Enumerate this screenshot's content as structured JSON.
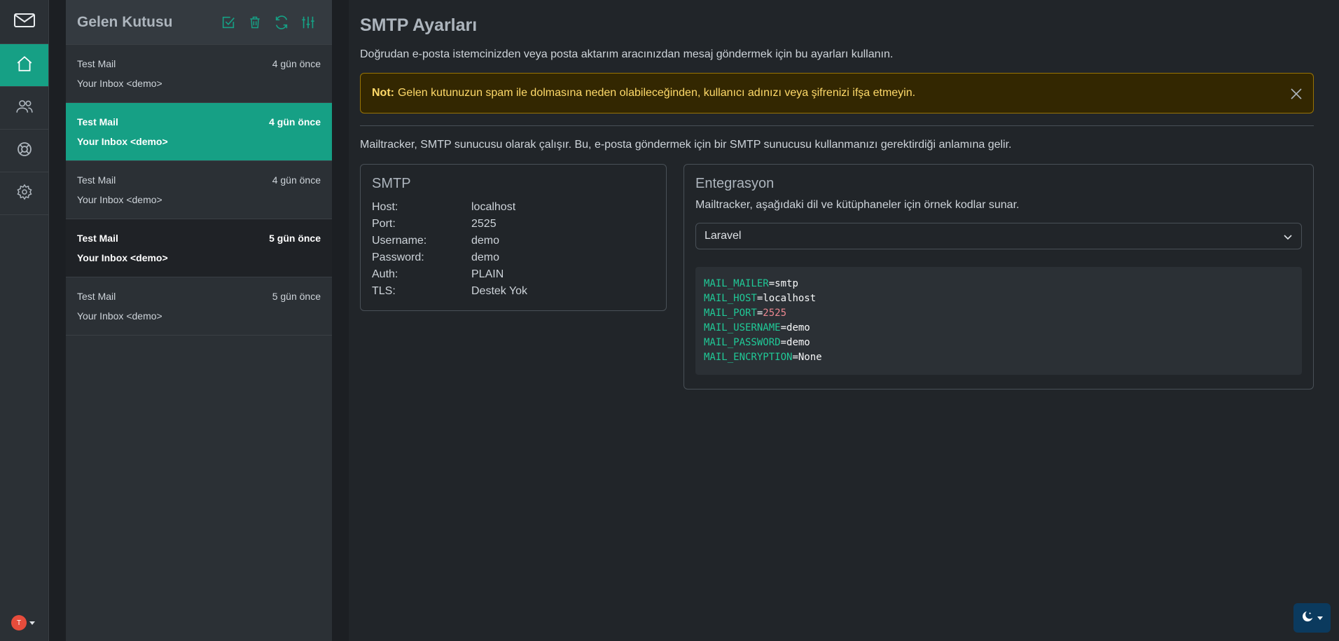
{
  "sidebar": {
    "logo": "mail-icon",
    "items": [
      {
        "icon": "home-icon",
        "active": true
      },
      {
        "icon": "users-icon",
        "active": false
      },
      {
        "icon": "help-icon",
        "active": false
      },
      {
        "icon": "gear-icon",
        "active": false
      }
    ],
    "avatar_initial": "T"
  },
  "inbox": {
    "title": "Gelen Kutusu",
    "mails": [
      {
        "subject": "Test Mail",
        "time": "4 gün önce",
        "from": "Your Inbox <demo>",
        "state": "read"
      },
      {
        "subject": "Test Mail",
        "time": "4 gün önce",
        "from": "Your Inbox <demo>",
        "state": "selected"
      },
      {
        "subject": "Test Mail",
        "time": "4 gün önce",
        "from": "Your Inbox <demo>",
        "state": "read"
      },
      {
        "subject": "Test Mail",
        "time": "5 gün önce",
        "from": "Your Inbox <demo>",
        "state": "unread"
      },
      {
        "subject": "Test Mail",
        "time": "5 gün önce",
        "from": "Your Inbox <demo>",
        "state": "read"
      }
    ]
  },
  "main": {
    "title": "SMTP Ayarları",
    "description": "Doğrudan e-posta istemcinizden veya posta aktarım aracınızdan mesaj göndermek için bu ayarları kullanın.",
    "alert": {
      "label": "Not:",
      "text": "Gelen kutunuzun spam ile dolmasına neden olabileceğinden, kullanıcı adınızı veya şifrenizi ifşa etmeyin."
    },
    "info": "Mailtracker, SMTP sunucusu olarak çalışır. Bu, e-posta göndermek için bir SMTP sunucusu kullanmanızı gerektirdiği anlamına gelir.",
    "smtp": {
      "title": "SMTP",
      "rows": [
        {
          "key": "Host:",
          "value": "localhost"
        },
        {
          "key": "Port:",
          "value": "2525"
        },
        {
          "key": "Username:",
          "value": "demo"
        },
        {
          "key": "Password:",
          "value": "demo"
        },
        {
          "key": "Auth:",
          "value": "PLAIN"
        },
        {
          "key": "TLS:",
          "value": "Destek Yok"
        }
      ]
    },
    "integration": {
      "title": "Entegrasyon",
      "description": "Mailtracker, aşağıdaki dil ve kütüphaneler için örnek kodlar sunar.",
      "selected": "Laravel",
      "code": [
        {
          "key": "MAIL_MAILER",
          "value": "smtp",
          "numeric": false
        },
        {
          "key": "MAIL_HOST",
          "value": "localhost",
          "numeric": false
        },
        {
          "key": "MAIL_PORT",
          "value": "2525",
          "numeric": true
        },
        {
          "key": "MAIL_USERNAME",
          "value": "demo",
          "numeric": false
        },
        {
          "key": "MAIL_PASSWORD",
          "value": "demo",
          "numeric": false
        },
        {
          "key": "MAIL_ENCRYPTION",
          "value": "None",
          "numeric": false
        }
      ]
    }
  },
  "colors": {
    "accent": "#16a085",
    "alert_bg": "#332701",
    "alert_text": "#ffda6a"
  }
}
